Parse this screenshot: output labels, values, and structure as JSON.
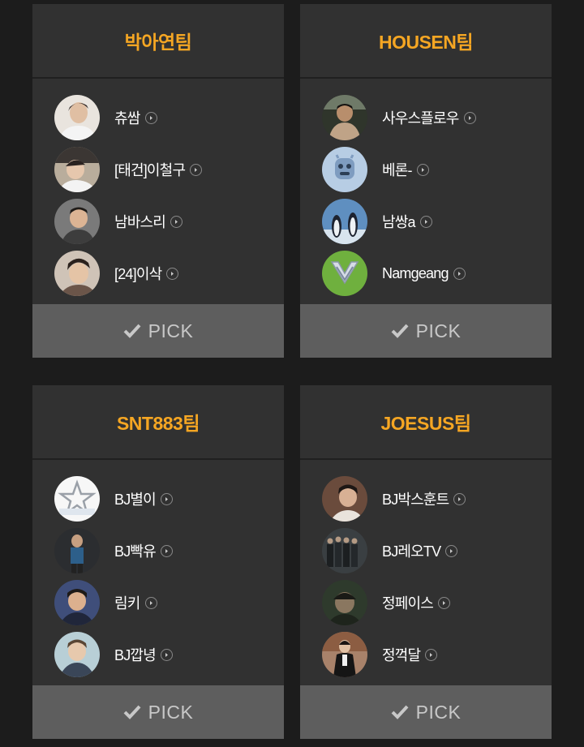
{
  "pick_label": "PICK",
  "accent_color": "#f5a623",
  "teams": [
    {
      "name": "박아연팀",
      "members": [
        {
          "name": "츄쌈",
          "avatar": "avatar-photo-1"
        },
        {
          "name": "[태건]이철구",
          "avatar": "avatar-photo-2"
        },
        {
          "name": "남바스리",
          "avatar": "avatar-photo-3"
        },
        {
          "name": "[24]이삭",
          "avatar": "avatar-photo-4"
        }
      ]
    },
    {
      "name": "HOUSEN팀",
      "members": [
        {
          "name": "사우스플로우",
          "avatar": "avatar-photo-5"
        },
        {
          "name": "베론-",
          "avatar": "robot-avatar"
        },
        {
          "name": "남쌍a",
          "avatar": "penguins-avatar"
        },
        {
          "name": "Namgeang",
          "avatar": "rank-emblem-avatar"
        }
      ]
    },
    {
      "name": "SNT883팀",
      "members": [
        {
          "name": "BJ별이",
          "avatar": "star-logo-avatar"
        },
        {
          "name": "BJ빡유",
          "avatar": "avatar-photo-6"
        },
        {
          "name": "림키",
          "avatar": "avatar-photo-7"
        },
        {
          "name": "BJ깝녕",
          "avatar": "avatar-photo-8"
        }
      ]
    },
    {
      "name": "JOESUS팀",
      "members": [
        {
          "name": "BJ박스훈트",
          "avatar": "avatar-photo-9"
        },
        {
          "name": "BJ레오TV",
          "avatar": "group-photo-avatar"
        },
        {
          "name": "정페이스",
          "avatar": "avatar-photo-10"
        },
        {
          "name": "정꺽달",
          "avatar": "avatar-photo-11"
        }
      ]
    }
  ]
}
